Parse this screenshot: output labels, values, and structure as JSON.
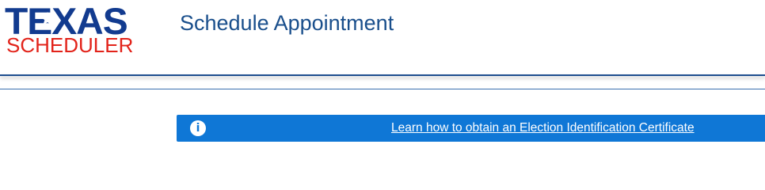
{
  "header": {
    "logo_top": "TEXAS",
    "logo_bottom": "SCHEDULER",
    "title": "Schedule Appointment",
    "colors": {
      "logo_blue": "#123b8f",
      "logo_red": "#e2231a",
      "title": "#1a4f8c",
      "rule": "#1e4e8f"
    }
  },
  "banner": {
    "icon": "info-icon",
    "icon_glyph": "i",
    "link_text": "Learn how to obtain an Election Identification Certificate",
    "background": "#0f77d6"
  }
}
